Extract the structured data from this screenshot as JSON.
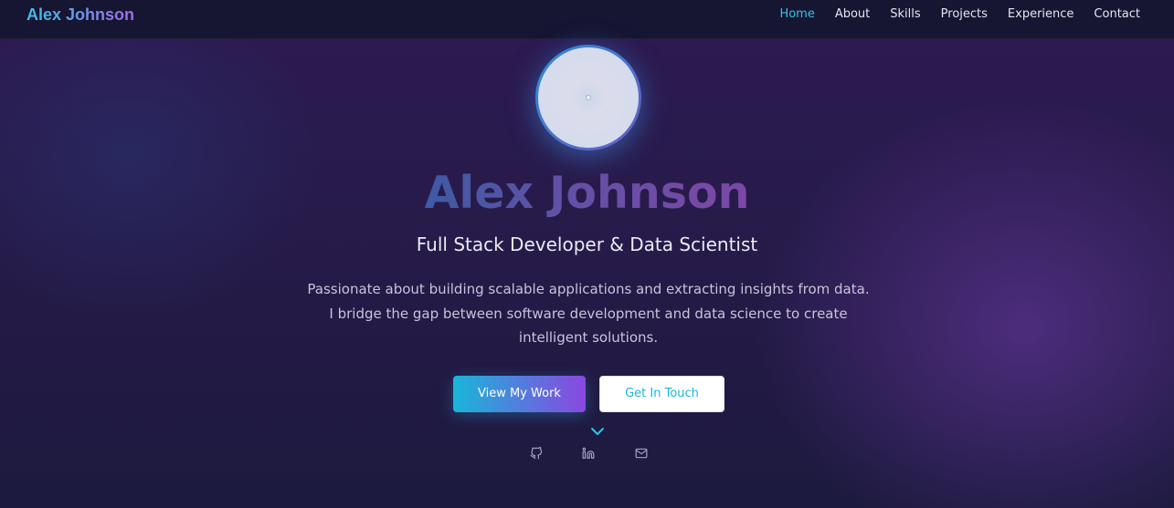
{
  "nav": {
    "brand": "Alex Johnson",
    "links": [
      {
        "label": "Home",
        "active": true
      },
      {
        "label": "About"
      },
      {
        "label": "Skills"
      },
      {
        "label": "Projects"
      },
      {
        "label": "Experience"
      },
      {
        "label": "Contact"
      }
    ]
  },
  "hero": {
    "name": "Alex Johnson",
    "role": "Full Stack Developer & Data Scientist",
    "description": "Passionate about building scalable applications and extracting insights from data. I bridge the gap between software development and data science to create intelligent solutions.",
    "primary_button": "View My Work",
    "secondary_button": "Get In Touch"
  },
  "icons": {
    "scroll": "chevron-down-icon",
    "social": [
      "github-icon",
      "linkedin-icon",
      "mail-icon"
    ]
  },
  "colors": {
    "accent_cyan": "#19b6d9",
    "accent_purple": "#8a47e0",
    "nav_background": "#161532",
    "active_link": "#2ec7e6"
  }
}
